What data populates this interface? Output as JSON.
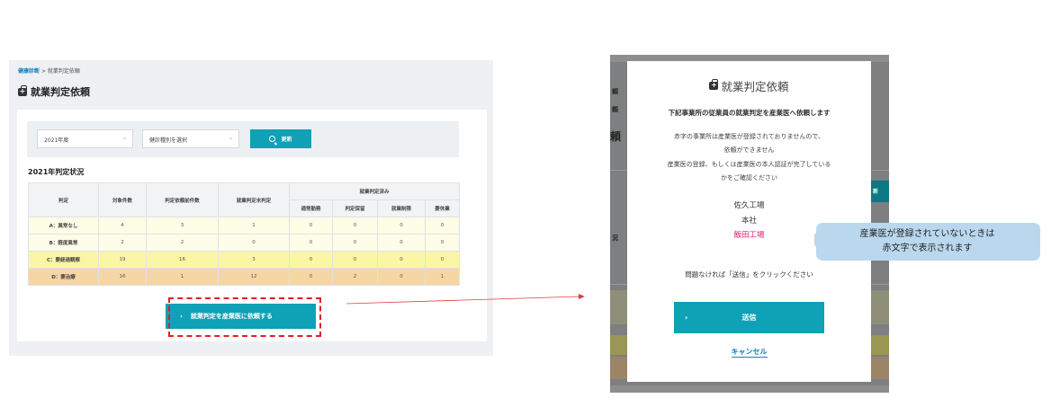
{
  "breadcrumb": {
    "link": "健康診断",
    "separator": ">",
    "current": "就業判定依頼"
  },
  "page_title": "就業判定依頼",
  "filters": {
    "year": "2021年度",
    "exam_type": "健診種別を選択",
    "update_button": "更新"
  },
  "section_title": "2021年判定状況",
  "table": {
    "headers": {
      "grade": "判定",
      "target": "対象件数",
      "requested": "判定依頼前件数",
      "undetermined": "就業判定未判定",
      "done_group": "就業判定済み",
      "done_cols": [
        "通常勤務",
        "判定保留",
        "就業制限",
        "要休業"
      ]
    },
    "rows": [
      {
        "grade": "A：異常なし",
        "values": [
          "4",
          "3",
          "1",
          "0",
          "0",
          "0",
          "0"
        ]
      },
      {
        "grade": "B：軽度異常",
        "values": [
          "2",
          "2",
          "0",
          "0",
          "0",
          "0",
          "0"
        ]
      },
      {
        "grade": "C：要経過観察",
        "values": [
          "19",
          "16",
          "3",
          "0",
          "0",
          "0",
          "0"
        ]
      },
      {
        "grade": "D：要治療",
        "values": [
          "16",
          "1",
          "12",
          "0",
          "2",
          "0",
          "1"
        ]
      }
    ]
  },
  "request_button": "就業判定を産業医に依頼する",
  "background": {
    "fragments": [
      "頼",
      "頼",
      "頼",
      "況",
      "新"
    ]
  },
  "modal": {
    "title": "就業判定依頼",
    "lead": "下記事業所の従業員の就業判定を産業医へ依頼します",
    "notice": [
      "赤字の事業所は産業医が登録されておりませんので、",
      "依頼ができません",
      "産業医の登録、もしくは産業医の本人認証が完了している",
      "かをご確認ください"
    ],
    "offices": [
      {
        "name": "佐久工場",
        "registered": true
      },
      {
        "name": "本社",
        "registered": true
      },
      {
        "name": "飯田工場",
        "registered": false
      }
    ],
    "confirm": "問題なければ「送信」をクリックください",
    "send_button": "送信",
    "cancel_link": "キャンセル"
  },
  "callout": {
    "lines": [
      "産業医が登録されていないときは",
      "赤文字で表示されます"
    ]
  },
  "colors": {
    "accent": "#0fa1b6",
    "unregistered": "#d8206a",
    "highlight_border": "#e02020",
    "callout_bg": "#b9d8ee"
  }
}
